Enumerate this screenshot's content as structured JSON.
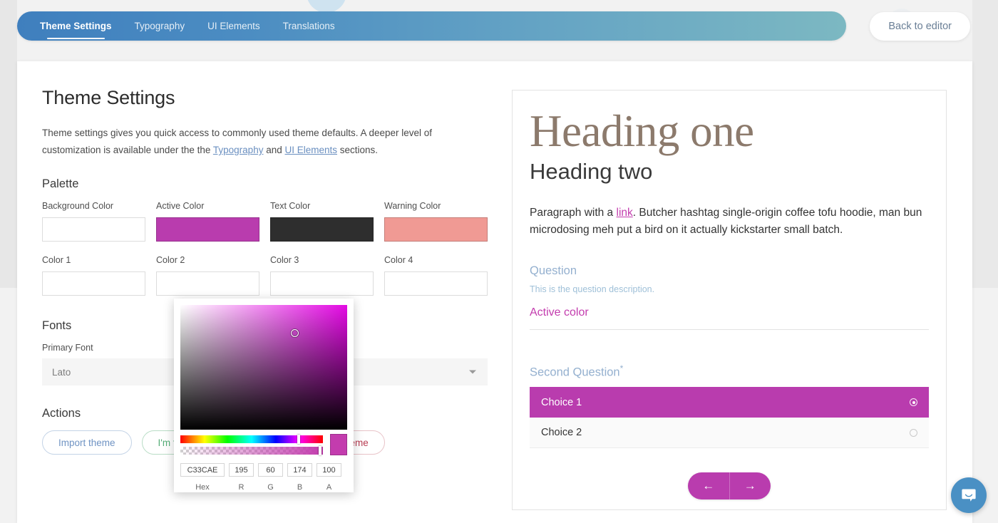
{
  "nav": {
    "items": [
      {
        "label": "Theme Settings",
        "active": true
      },
      {
        "label": "Typography",
        "active": false
      },
      {
        "label": "UI Elements",
        "active": false
      },
      {
        "label": "Translations",
        "active": false
      }
    ],
    "back_button": "Back to editor"
  },
  "left": {
    "page_title": "Theme Settings",
    "intro_part1": "Theme settings gives you quick access to commonly used theme defaults. A deeper level of customization is available under the the ",
    "intro_link1": "Typography",
    "intro_and": " and ",
    "intro_link2": "UI Elements",
    "intro_part2": " sections.",
    "palette_heading": "Palette",
    "swatches": [
      {
        "label": "Background Color",
        "color": "",
        "filled": false
      },
      {
        "label": "Active Color",
        "color": "#b93cae",
        "filled": true
      },
      {
        "label": "Text Color",
        "color": "#2e2e2e",
        "filled": true
      },
      {
        "label": "Warning Color",
        "color": "#f09a94",
        "filled": true
      },
      {
        "label": "Color 1",
        "color": "",
        "filled": false
      },
      {
        "label": "Color 2",
        "color": "",
        "filled": false
      },
      {
        "label": "Color 3",
        "color": "",
        "filled": false
      },
      {
        "label": "Color 4",
        "color": "",
        "filled": false
      }
    ],
    "fonts_heading": "Fonts",
    "primary_font_label": "Primary Font",
    "primary_font_value": "Lato",
    "actions_heading": "Actions",
    "actions": [
      {
        "label": "Import theme",
        "style": "blue"
      },
      {
        "label": "I'm feeling lucky!",
        "style": "green"
      },
      {
        "label": "Reset to default theme",
        "style": "red"
      }
    ]
  },
  "picker": {
    "hex": "C33CAE",
    "r": "195",
    "g": "60",
    "b": "174",
    "a": "100",
    "hex_label": "Hex",
    "r_label": "R",
    "g_label": "G",
    "b_label": "B",
    "a_label": "A",
    "preview_color": "#c33cae"
  },
  "preview": {
    "heading_one": "Heading one",
    "heading_two": "Heading two",
    "paragraph_before": "Paragraph with a ",
    "paragraph_link": "link",
    "paragraph_after": ". Butcher hashtag single-origin coffee tofu hoodie, man bun microdosing meh put a bird on it actually kickstarter small batch.",
    "question_title": "Question",
    "question_description": "This is the question description.",
    "question_value": "Active color",
    "second_question_title": "Second Question",
    "second_question_required": "*",
    "choices": [
      {
        "label": "Choice 1",
        "selected": true
      },
      {
        "label": "Choice 2",
        "selected": false
      }
    ],
    "prev_arrow": "←",
    "next_arrow": "→"
  },
  "colors": {
    "active": "#b93cae",
    "text": "#2e2e2e",
    "warning": "#f09a94",
    "picker": "#c33cae",
    "link": "#c33cae",
    "heading_one": "#8c7a6c",
    "question": "#94b0cf",
    "intercom": "#4a90c4"
  }
}
